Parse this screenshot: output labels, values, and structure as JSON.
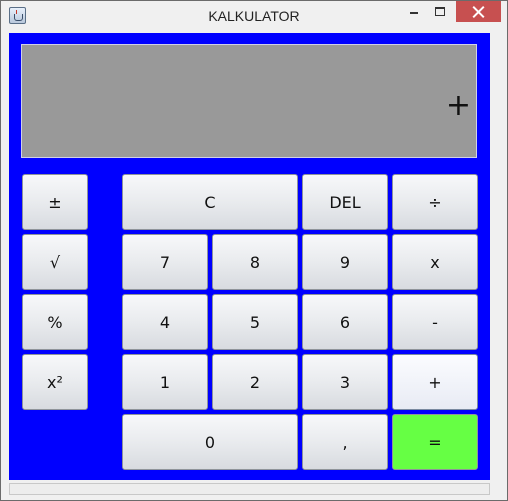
{
  "window": {
    "title": "KALKULATOR"
  },
  "display": {
    "value": "+"
  },
  "keys": {
    "plusminus": "±",
    "sqrt": "√",
    "percent": "%",
    "square": "x²",
    "clear": "C",
    "del": "DEL",
    "divide": "÷",
    "seven": "7",
    "eight": "8",
    "nine": "9",
    "multiply": "x",
    "four": "4",
    "five": "5",
    "six": "6",
    "minus": "-",
    "one": "1",
    "two": "2",
    "three": "3",
    "plus": "+",
    "zero": "0",
    "comma": ",",
    "equals": "="
  },
  "colors": {
    "panel": "#0000ff",
    "display": "#999999",
    "equals": "#66ff44",
    "close": "#c75050"
  }
}
